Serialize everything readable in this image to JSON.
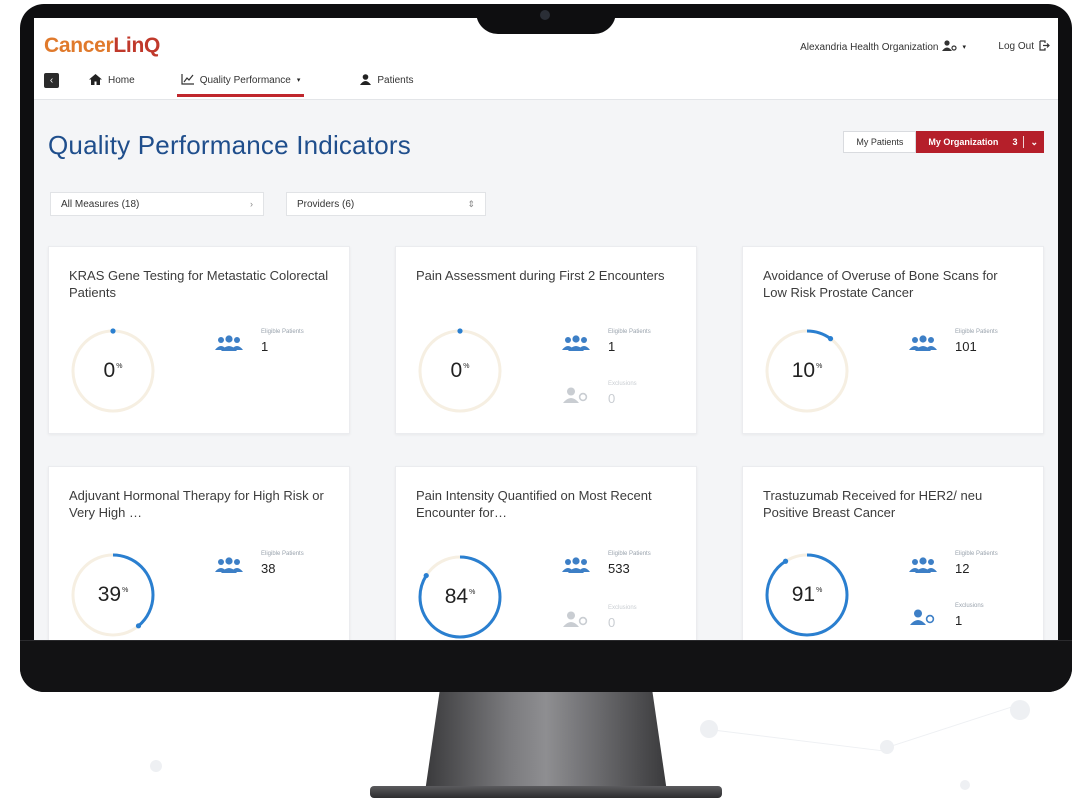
{
  "app": {
    "logo_part1": "Cancer",
    "logo_part2": "LinQ",
    "organization": "Alexandria Health Organization",
    "logout": "Log Out"
  },
  "nav": {
    "home": "Home",
    "quality": "Quality Performance",
    "patients": "Patients"
  },
  "header": {
    "title": "Quality Performance Indicators",
    "my_patients": "My Patients",
    "my_organization": "My Organization",
    "org_count": "3"
  },
  "filters": {
    "measures": "All Measures (18)",
    "providers": "Providers (6)"
  },
  "colors": {
    "brand_orange": "#e07a2c",
    "brand_red": "#c0392b",
    "accent_red": "#b51f2a",
    "title_blue": "#1f4e8c",
    "ring_blue": "#2a7fd0"
  },
  "cards": [
    {
      "title": "KRAS Gene Testing for Metastatic Colorectal Patients",
      "percent": 0,
      "percent_label": "0",
      "eligible_label": "Eligible Patients",
      "eligible": "1"
    },
    {
      "title": "Pain Assessment during First 2 Encounters",
      "percent": 0,
      "percent_label": "0",
      "eligible_label": "Eligible Patients",
      "eligible": "1",
      "second_label": "Exclusions",
      "second": "0"
    },
    {
      "title": "Avoidance of Overuse of Bone Scans for Low Risk Prostate Cancer",
      "percent": 10,
      "percent_label": "10",
      "eligible_label": "Eligible Patients",
      "eligible": "101"
    },
    {
      "title": "Adjuvant Hormonal Therapy for High Risk or Very High …",
      "percent": 39,
      "percent_label": "39",
      "eligible_label": "Eligible Patients",
      "eligible": "38"
    },
    {
      "title": "Pain Intensity Quantified on Most Recent Encounter for…",
      "percent": 84,
      "percent_label": "84",
      "eligible_label": "Eligible Patients",
      "eligible": "533",
      "second_label": "Exclusions",
      "second": "0"
    },
    {
      "title": "Trastuzumab Received for HER2/ neu Positive Breast Cancer",
      "percent": 91,
      "percent_label": "91",
      "eligible_label": "Eligible Patients",
      "eligible": "12",
      "second_label": "Exclusions",
      "second": "1"
    }
  ]
}
